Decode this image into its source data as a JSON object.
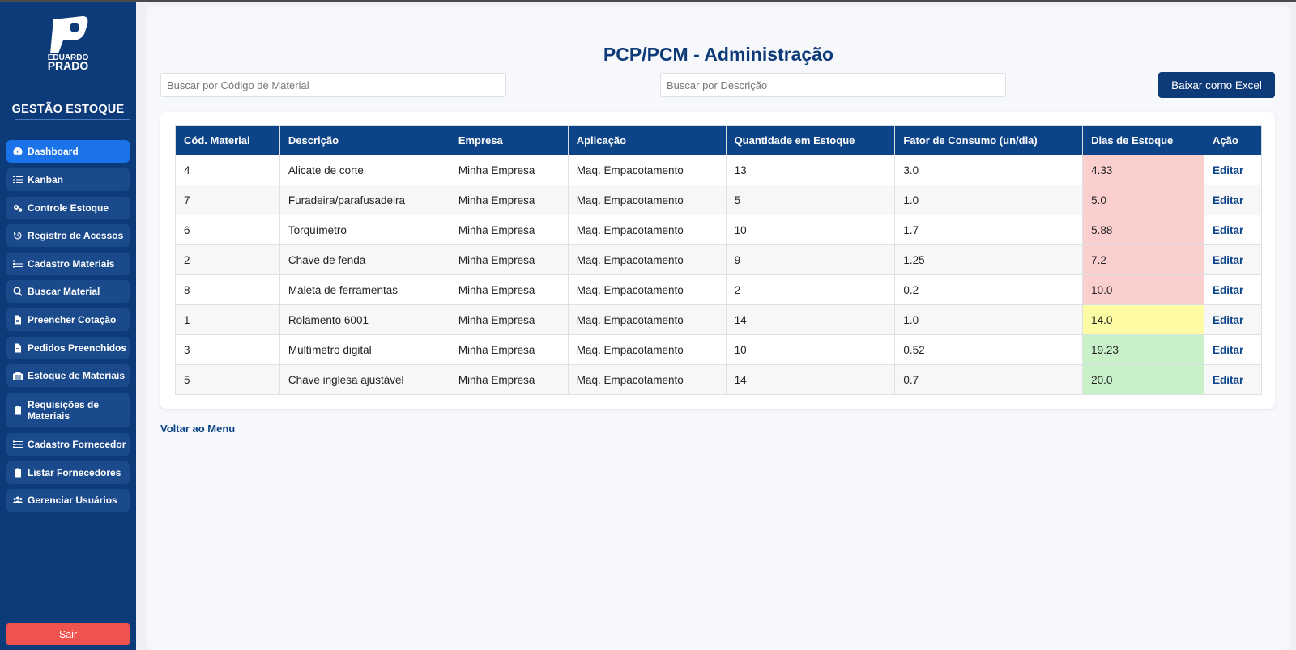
{
  "sidebar": {
    "logo_text": "EDUARDO PRADO",
    "title": "GESTÃO ESTOQUE",
    "items": [
      {
        "label": "Dashboard",
        "icon": "dashboard-gauge-icon"
      },
      {
        "label": "Kanban",
        "icon": "checklist-icon"
      },
      {
        "label": "Controle Estoque",
        "icon": "gears-icon"
      },
      {
        "label": "Registro de Acessos",
        "icon": "history-icon"
      },
      {
        "label": "Cadastro Materiais",
        "icon": "list-icon"
      },
      {
        "label": "Buscar Material",
        "icon": "search-icon"
      },
      {
        "label": "Preencher Cotação",
        "icon": "file-icon"
      },
      {
        "label": "Pedidos Preenchidos",
        "icon": "file-icon"
      },
      {
        "label": "Estoque de Materiais",
        "icon": "warehouse-icon"
      },
      {
        "label": "Requisições de Materiais",
        "icon": "clipboard-icon"
      },
      {
        "label": "Cadastro Fornecedor",
        "icon": "list-icon"
      },
      {
        "label": "Listar Fornecedores",
        "icon": "clipboard-icon"
      },
      {
        "label": "Gerenciar Usuários",
        "icon": "users-icon"
      }
    ],
    "active_item": "Dashboard",
    "logout_label": "Sair"
  },
  "main": {
    "title": "PCP/PCM - Administração",
    "search_code_placeholder": "Buscar por Código de Material",
    "search_desc_placeholder": "Buscar por Descrição",
    "excel_label": "Baixar como Excel",
    "back_label": "Voltar ao Menu"
  },
  "table": {
    "headers": [
      "Cód. Material",
      "Descrição",
      "Empresa",
      "Aplicação",
      "Quantidade em Estoque",
      "Fator de Consumo (un/dia)",
      "Dias de Estoque",
      "Ação"
    ],
    "rows": [
      {
        "code": "4",
        "desc": "Alicate de corte",
        "company": "Minha Empresa",
        "application": "Maq. Empacotamento",
        "qty": "13",
        "factor": "3.0",
        "days": "4.33",
        "status": "red",
        "action": "Editar"
      },
      {
        "code": "7",
        "desc": "Furadeira/parafusadeira",
        "company": "Minha Empresa",
        "application": "Maq. Empacotamento",
        "qty": "5",
        "factor": "1.0",
        "days": "5.0",
        "status": "red",
        "action": "Editar"
      },
      {
        "code": "6",
        "desc": "Torquímetro",
        "company": "Minha Empresa",
        "application": "Maq. Empacotamento",
        "qty": "10",
        "factor": "1.7",
        "days": "5.88",
        "status": "red",
        "action": "Editar"
      },
      {
        "code": "2",
        "desc": "Chave de fenda",
        "company": "Minha Empresa",
        "application": "Maq. Empacotamento",
        "qty": "9",
        "factor": "1.25",
        "days": "7.2",
        "status": "red",
        "action": "Editar"
      },
      {
        "code": "8",
        "desc": "Maleta de ferramentas",
        "company": "Minha Empresa",
        "application": "Maq. Empacotamento",
        "qty": "2",
        "factor": "0.2",
        "days": "10.0",
        "status": "red",
        "action": "Editar"
      },
      {
        "code": "1",
        "desc": "Rolamento 6001",
        "company": "Minha Empresa",
        "application": "Maq. Empacotamento",
        "qty": "14",
        "factor": "1.0",
        "days": "14.0",
        "status": "yellow",
        "action": "Editar"
      },
      {
        "code": "3",
        "desc": "Multímetro digital",
        "company": "Minha Empresa",
        "application": "Maq. Empacotamento",
        "qty": "10",
        "factor": "0.52",
        "days": "19.23",
        "status": "green",
        "action": "Editar"
      },
      {
        "code": "5",
        "desc": "Chave inglesa ajustável",
        "company": "Minha Empresa",
        "application": "Maq. Empacotamento",
        "qty": "14",
        "factor": "0.7",
        "days": "20.0",
        "status": "green",
        "action": "Editar"
      }
    ]
  },
  "colors": {
    "sidebar_bg": "#0d3a78",
    "nav_item_bg": "#1b4a8c",
    "nav_active_bg": "#1a73e8",
    "header_bg": "#0d4488",
    "logout_bg": "#ef5350",
    "days_red": "#fccfcf",
    "days_yellow": "#fdfca4",
    "days_green": "#c9f1c9"
  }
}
